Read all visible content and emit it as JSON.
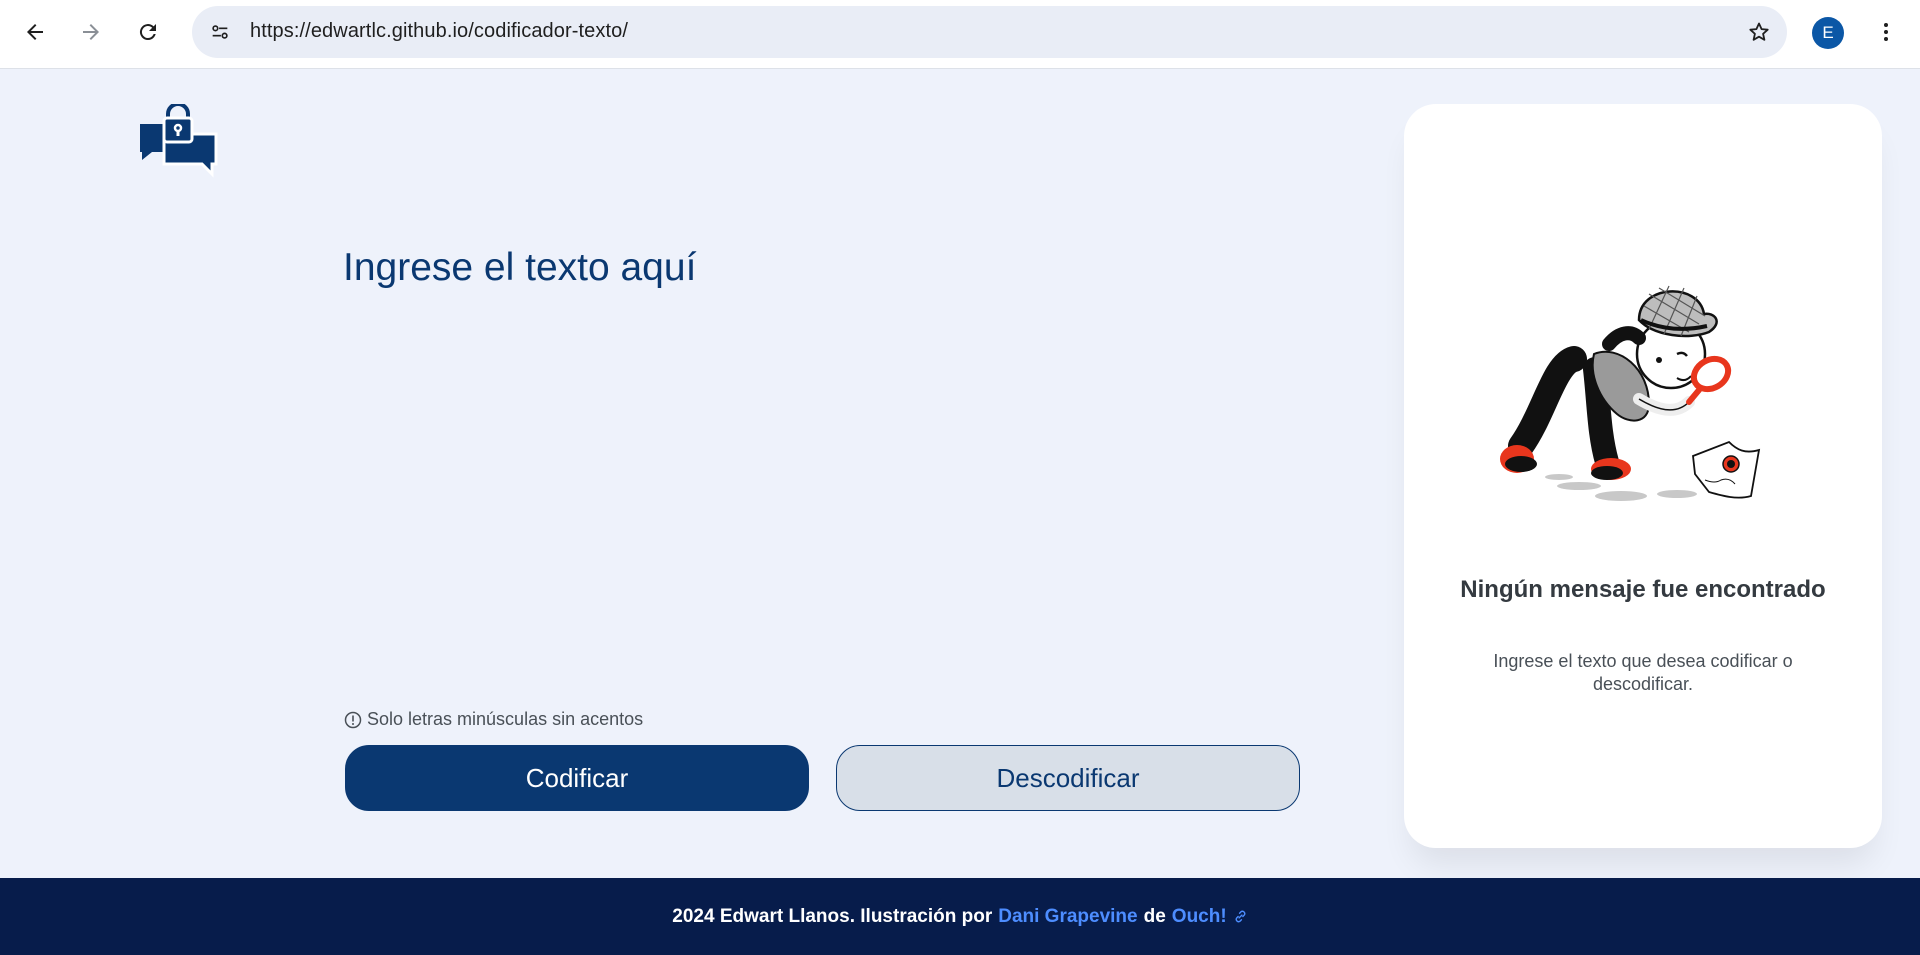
{
  "browser": {
    "url": "https://edwartlc.github.io/codificador-texto/",
    "profile_initial": "E"
  },
  "main": {
    "input_placeholder": "Ingrese el texto aquí",
    "hint": "Solo letras minúsculas sin acentos",
    "encode_label": "Codificar",
    "decode_label": "Descodificar"
  },
  "result": {
    "title": "Ningún mensaje fue encontrado",
    "text": "Ingrese el texto que desea codificar o descodificar."
  },
  "footer": {
    "prefix": "2024 Edwart Llanos. Ilustración por",
    "illustrator": "Dani Grapevine",
    "connector": "de",
    "source": "Ouch!"
  },
  "colors": {
    "accent": "#0a3871",
    "footer_bg": "#071c4b",
    "link": "#4d8dff",
    "page_bg": "#eef2fb"
  }
}
